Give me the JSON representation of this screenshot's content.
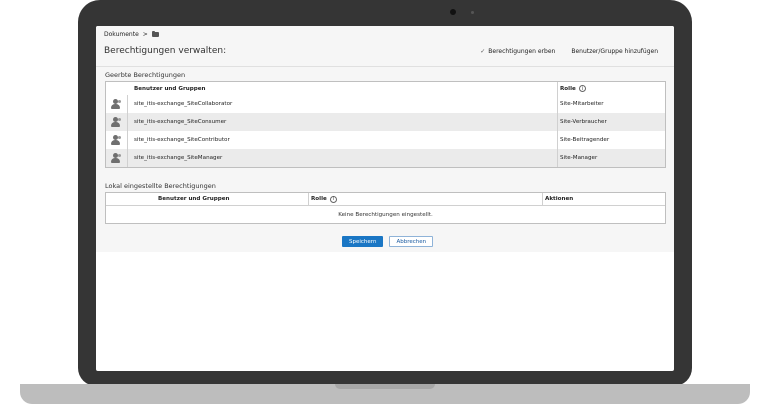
{
  "breadcrumb": {
    "root": "Dokumente",
    "separator": ">"
  },
  "header": {
    "title": "Berechtigungen verwalten:",
    "inherit_label": "Berechtigungen erben",
    "add_label": "Benutzer/Gruppe hinzufügen"
  },
  "inherited": {
    "label": "Geerbte Berechtigungen",
    "col_users": "Benutzer und Gruppen",
    "col_role": "Rolle",
    "rows": [
      {
        "name": "site_itis-exchange_SiteCollaborator",
        "role": "Site-Mitarbeiter"
      },
      {
        "name": "site_itis-exchange_SiteConsumer",
        "role": "Site-Verbraucher"
      },
      {
        "name": "site_itis-exchange_SiteContributor",
        "role": "Site-Beitragender"
      },
      {
        "name": "site_itis-exchange_SiteManager",
        "role": "Site-Manager"
      }
    ]
  },
  "local": {
    "label": "Lokal eingestellte Berechtigungen",
    "col_users": "Benutzer und Gruppen",
    "col_role": "Rolle",
    "col_actions": "Aktionen",
    "empty": "Keine Berechtigungen eingestellt."
  },
  "actions": {
    "save": "Speichern",
    "cancel": "Abbrechen"
  },
  "icons": {
    "info": "i"
  },
  "colors": {
    "primary": "#1a76c4",
    "bezel": "#353535"
  }
}
